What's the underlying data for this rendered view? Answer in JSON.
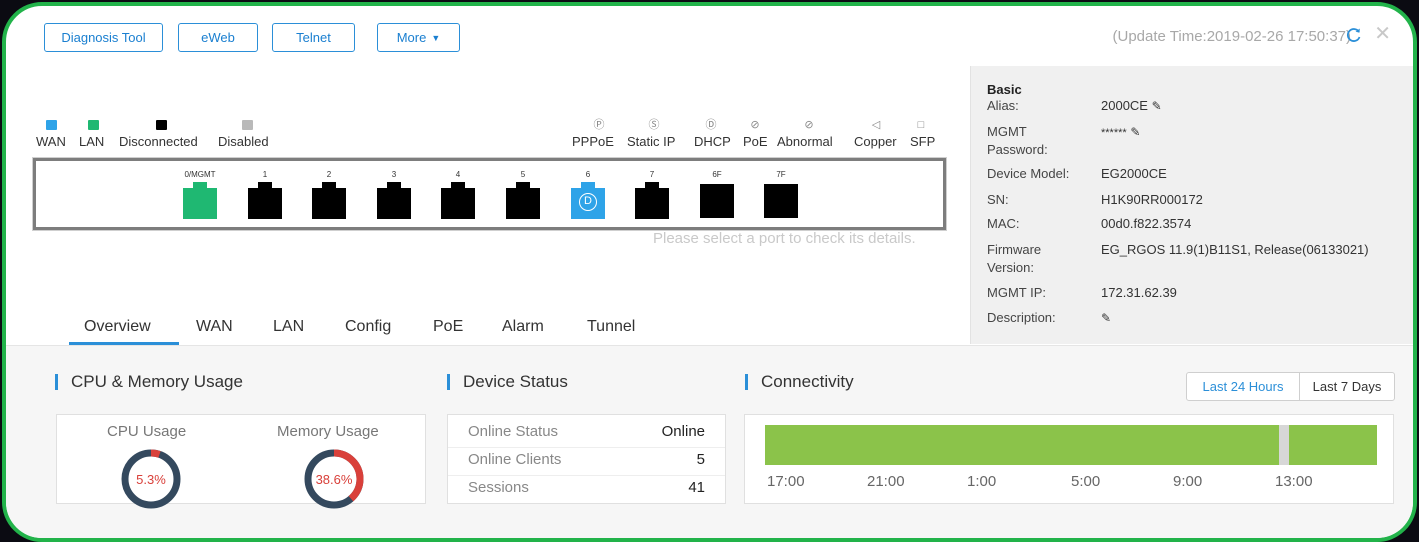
{
  "toolbar": {
    "diagnosis_label": "Diagnosis Tool",
    "eweb_label": "eWeb",
    "telnet_label": "Telnet",
    "more_label": "More",
    "update_time": "(Update Time:2019-02-26 17:50:37)"
  },
  "legend": {
    "wan": "WAN",
    "lan": "LAN",
    "disconnected": "Disconnected",
    "disabled": "Disabled",
    "pppoe": "PPPoE",
    "static_ip": "Static IP",
    "dhcp": "DHCP",
    "poe": "PoE",
    "abnormal": "Abnormal",
    "copper": "Copper",
    "sfp": "SFP"
  },
  "ports": [
    {
      "label": "0/MGMT",
      "state": "lan"
    },
    {
      "label": "1",
      "state": "disconnected"
    },
    {
      "label": "2",
      "state": "disconnected"
    },
    {
      "label": "3",
      "state": "disconnected"
    },
    {
      "label": "4",
      "state": "disconnected"
    },
    {
      "label": "5",
      "state": "disconnected"
    },
    {
      "label": "6",
      "state": "wan",
      "badge": "D"
    },
    {
      "label": "7",
      "state": "disconnected"
    },
    {
      "label": "6F",
      "state": "disconnected",
      "type": "sfp"
    },
    {
      "label": "7F",
      "state": "disconnected",
      "type": "sfp"
    }
  ],
  "port_hint": "Please select a port to check its details.",
  "info": {
    "section": "Basic",
    "alias_label": "Alias:",
    "alias_value": "2000CE",
    "mgmt_pw_label_1": "MGMT",
    "mgmt_pw_label_2": "Password:",
    "mgmt_pw_value": "******",
    "model_label": "Device Model:",
    "model_value": "EG2000CE",
    "sn_label": "SN:",
    "sn_value": "H1K90RR000172",
    "mac_label": "MAC:",
    "mac_value": "00d0.f822.3574",
    "fw_label_1": "Firmware",
    "fw_label_2": "Version:",
    "fw_value": "EG_RGOS 11.9(1)B11S1, Release(06133021)",
    "ip_label": "MGMT IP:",
    "ip_value": "172.31.62.39",
    "desc_label": "Description:"
  },
  "tabs": [
    "Overview",
    "WAN",
    "LAN",
    "Config",
    "PoE",
    "Alarm",
    "Tunnel"
  ],
  "active_tab": "Overview",
  "cpu_mem": {
    "title": "CPU & Memory Usage",
    "cpu_label": "CPU Usage",
    "cpu_value": "5.3%",
    "cpu_fraction": 0.053,
    "mem_label": "Memory Usage",
    "mem_value": "38.6%",
    "mem_fraction": 0.386
  },
  "device_status": {
    "title": "Device Status",
    "rows": [
      {
        "label": "Online Status",
        "value": "Online"
      },
      {
        "label": "Online Clients",
        "value": "5"
      },
      {
        "label": "Sessions",
        "value": "41"
      }
    ]
  },
  "connectivity": {
    "title": "Connectivity",
    "range_24h": "Last 24 Hours",
    "range_7d": "Last 7 Days",
    "active_range": "Last 24 Hours",
    "ticks": [
      "17:00",
      "21:00",
      "1:00",
      "5:00",
      "9:00",
      "13:00"
    ],
    "gap_fraction": 0.84
  },
  "colors": {
    "accent": "#2b8fd8",
    "wan": "#2ea3e8",
    "lan": "#1fb872",
    "disconnected": "#000000",
    "disabled": "#b9b9b9",
    "online_bar": "#8bc34a",
    "gauge_used": "#d9403a",
    "gauge_free": "#34495e",
    "frame": "#22b34a"
  }
}
